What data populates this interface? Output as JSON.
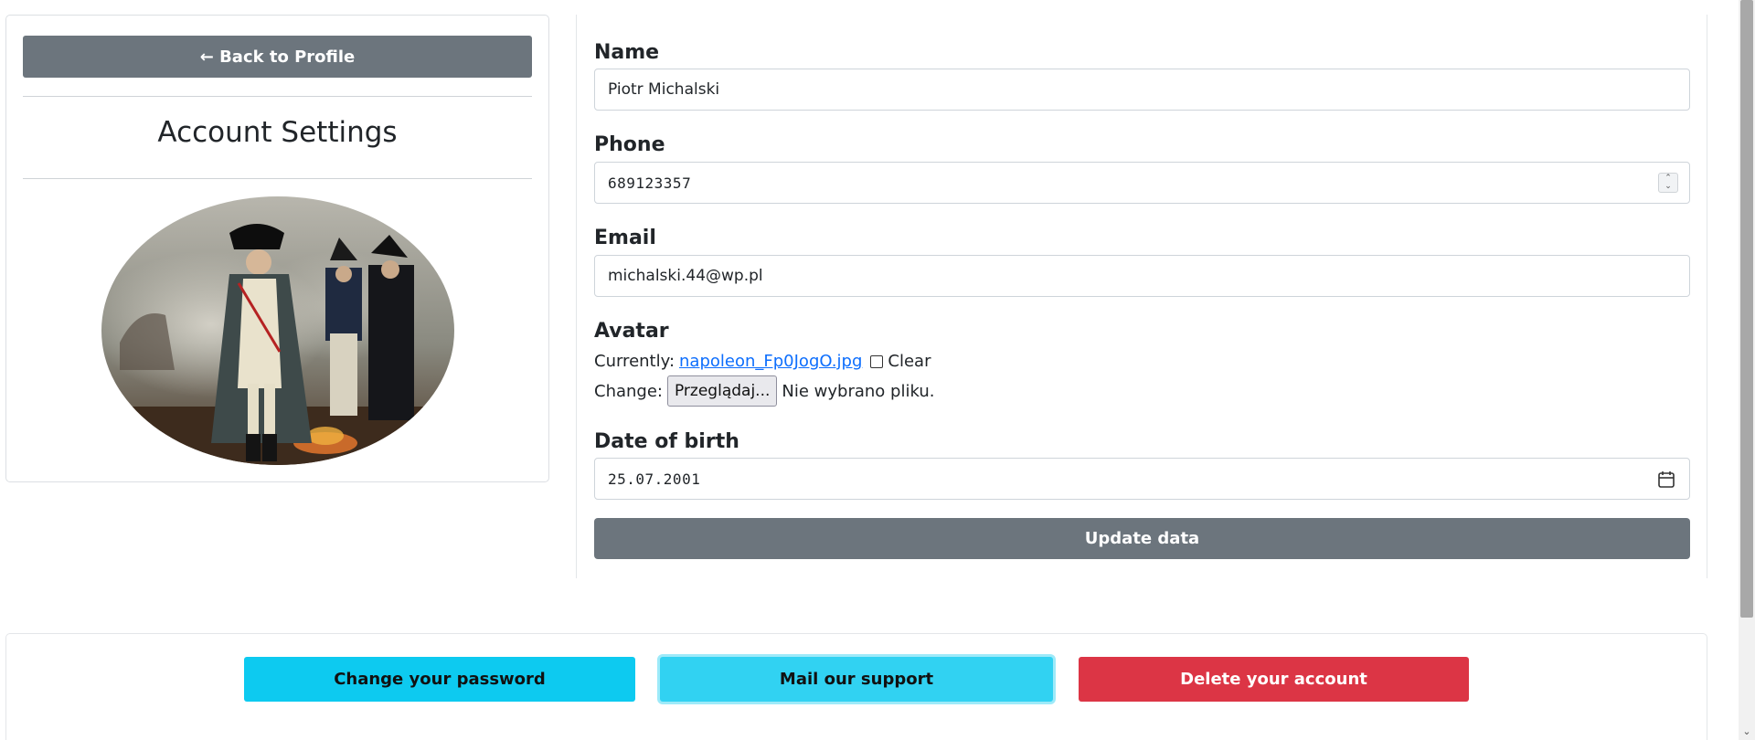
{
  "left": {
    "back_label": "← Back to Profile",
    "title": "Account Settings"
  },
  "form": {
    "name_label": "Name",
    "name_value": "Piotr Michalski",
    "phone_label": "Phone",
    "phone_value": "689123357",
    "email_label": "Email",
    "email_value": "michalski.44@wp.pl",
    "avatar_label": "Avatar",
    "currently_text": "Currently:",
    "current_file": "napoleon_Fp0JogO.jpg",
    "clear_text": "Clear",
    "change_text": "Change:",
    "browse_label": "Przeglądaj...",
    "no_file_text": "Nie wybrano pliku.",
    "dob_label": "Date of birth",
    "dob_value": "25.07.2001",
    "update_label": "Update data"
  },
  "actions": {
    "password_label": "Change your password",
    "support_label": "Mail our support",
    "delete_label": "Delete your account"
  },
  "colors": {
    "secondary": "#6c757d",
    "info": "#0dcaf0",
    "danger": "#dc3545",
    "link": "#0d6efd"
  }
}
